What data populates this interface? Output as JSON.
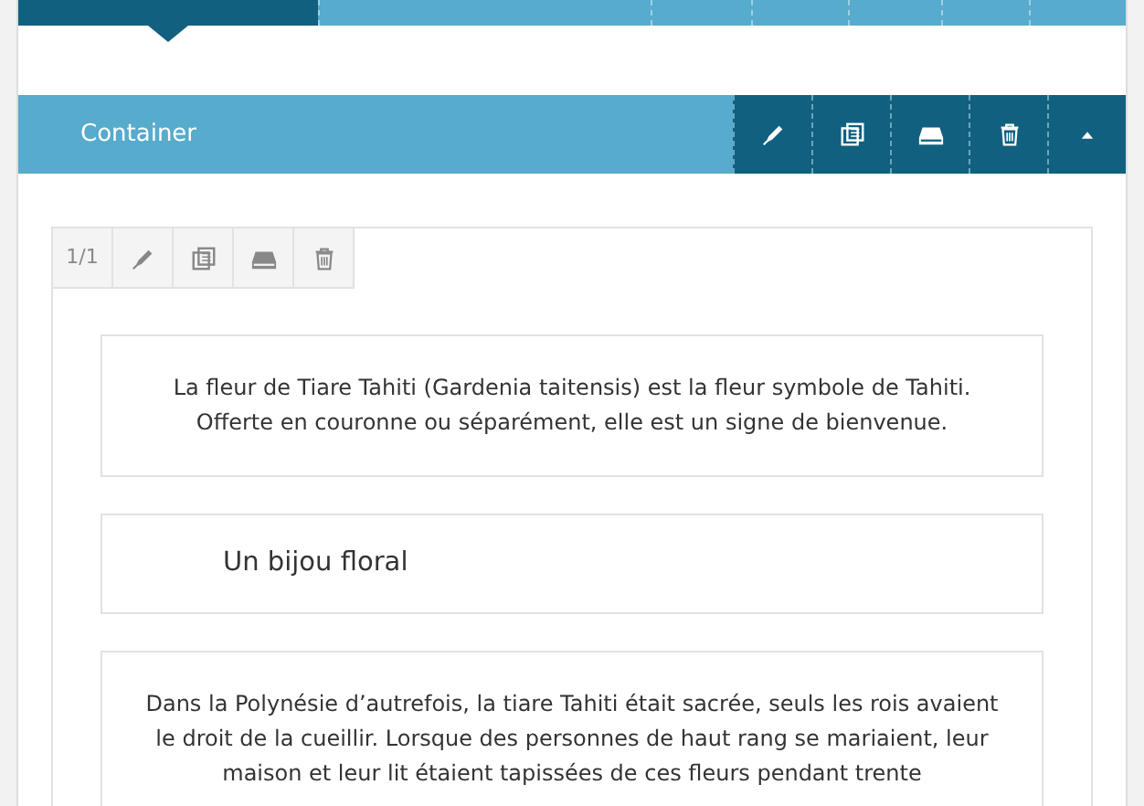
{
  "tabs": [
    {
      "selected": true
    },
    {
      "selected": false
    },
    {
      "selected": false
    },
    {
      "selected": false
    },
    {
      "selected": false
    },
    {
      "selected": false
    },
    {
      "selected": false
    }
  ],
  "container": {
    "title": "Container",
    "actions": [
      {
        "kind": "edit"
      },
      {
        "kind": "duplicate"
      },
      {
        "kind": "template"
      },
      {
        "kind": "delete"
      },
      {
        "kind": "collapse"
      }
    ]
  },
  "block_toolbar": {
    "counter": "1/1",
    "actions": [
      {
        "kind": "edit"
      },
      {
        "kind": "duplicate"
      },
      {
        "kind": "template"
      },
      {
        "kind": "delete"
      }
    ]
  },
  "blocks": [
    {
      "kind": "paragraph",
      "lines": [
        "La fleur de Tiare Tahiti (Gardenia taitensis) est la fleur symbole de Tahiti.",
        "Offerte en couronne ou séparément, elle est un signe de bienvenue."
      ]
    },
    {
      "kind": "heading",
      "lines": [
        "Un bijou floral"
      ]
    },
    {
      "kind": "paragraph",
      "lines": [
        "Dans la Polynésie d’autrefois, la tiare Tahiti était sacrée, seuls les rois avaient",
        "le droit de la cueillir. Lorsque des personnes de haut rang se mariaient, leur",
        "maison et leur lit étaient tapissées de ces fleurs pendant trente"
      ]
    }
  ]
}
